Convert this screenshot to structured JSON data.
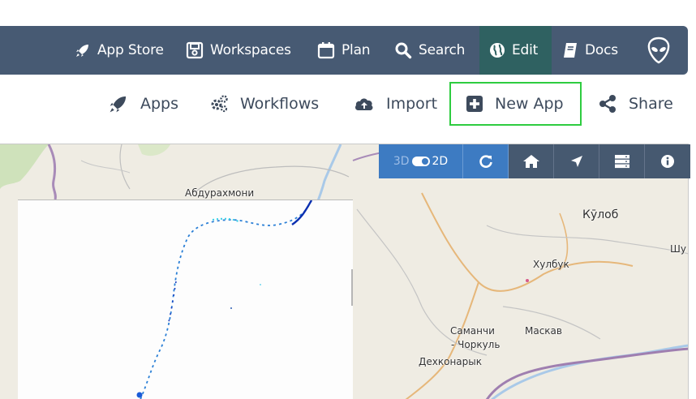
{
  "nav": {
    "app_store": "App Store",
    "workspaces": "Workspaces",
    "plan": "Plan",
    "search": "Search",
    "edit": "Edit",
    "docs": "Docs"
  },
  "toolbar": {
    "apps": "Apps",
    "workflows": "Workflows",
    "import": "Import",
    "new_app": "New App",
    "share": "Share"
  },
  "map": {
    "labels": {
      "abdurakhmoni": "Абдурахмони",
      "kulob": "Кӯлоб",
      "khulbuk": "Хулбук",
      "samanchi": "Саманчи",
      "chorkul": "- Чоркуль",
      "maskav": "Маскав",
      "dekhkanaryk": "Дехконарык",
      "shu": "Шу"
    },
    "controls": {
      "mode_3d": "3D",
      "mode_2d": "2D"
    }
  },
  "colors": {
    "nav_bg": "#475a73",
    "nav_active": "#2f6161",
    "highlight_border": "#2ecc40",
    "control_blue": "#3d7bc2",
    "control_dark": "#465970"
  }
}
